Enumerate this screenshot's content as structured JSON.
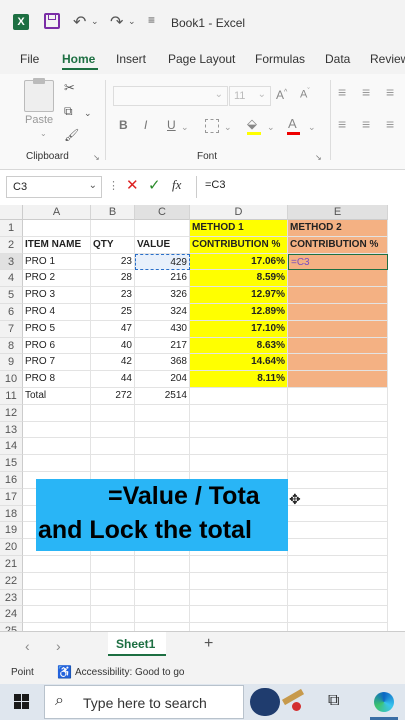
{
  "titlebar": {
    "title": "Book1 - Excel",
    "excel_color": "#1d6f42"
  },
  "menu": [
    "File",
    "Home",
    "Insert",
    "Page Layout",
    "Formulas",
    "Data",
    "Review"
  ],
  "ribbon": {
    "paste_label": "Paste",
    "clipboard_label": "Clipboard",
    "font_label": "Font",
    "font_size": "11",
    "bold": "B",
    "italic": "I",
    "underline": "U"
  },
  "formula_bar": {
    "name_box": "C3",
    "fx": "fx",
    "formula": "=C3"
  },
  "grid": {
    "columns": [
      "A",
      "B",
      "C",
      "D",
      "E"
    ],
    "rows": [
      "1",
      "2",
      "3",
      "4",
      "5",
      "6",
      "7",
      "8",
      "9",
      "10",
      "11",
      "12",
      "13",
      "14",
      "15",
      "16",
      "17",
      "18",
      "19",
      "20",
      "21",
      "22",
      "23",
      "24",
      "25"
    ],
    "d1": "METHOD 1",
    "d2": "CONTRIBUTION %",
    "e1": "METHOD 2",
    "e2": "CONTRIBUTION %",
    "headers": [
      "ITEM NAME",
      "QTY",
      "VALUE"
    ],
    "data_rows": [
      {
        "name": "PRO 1",
        "qty": "23",
        "value": "429",
        "pct": "17.06%"
      },
      {
        "name": "PRO 2",
        "qty": "28",
        "value": "216",
        "pct": "8.59%"
      },
      {
        "name": "PRO 3",
        "qty": "23",
        "value": "326",
        "pct": "12.97%"
      },
      {
        "name": "PRO 4",
        "qty": "25",
        "value": "324",
        "pct": "12.89%"
      },
      {
        "name": "PRO 5",
        "qty": "47",
        "value": "430",
        "pct": "17.10%"
      },
      {
        "name": "PRO 6",
        "qty": "40",
        "value": "217",
        "pct": "8.63%"
      },
      {
        "name": "PRO 7",
        "qty": "42",
        "value": "368",
        "pct": "14.64%"
      },
      {
        "name": "PRO 8",
        "qty": "44",
        "value": "204",
        "pct": "8.11%"
      }
    ],
    "total": {
      "name": "Total",
      "qty": "272",
      "value": "2514"
    },
    "e3_edit": "=C3",
    "method1_color": "#ffff00",
    "method2_color": "#f4b183"
  },
  "overlay": {
    "line1": "=Value / Tota",
    "line2": "and Lock the total",
    "bg": "#29b5f6"
  },
  "sheet_tab": "Sheet1",
  "status": {
    "mode": "Point",
    "accessibility": "Accessibility: Good to go"
  },
  "taskbar": {
    "search_placeholder": "Type here to search"
  }
}
